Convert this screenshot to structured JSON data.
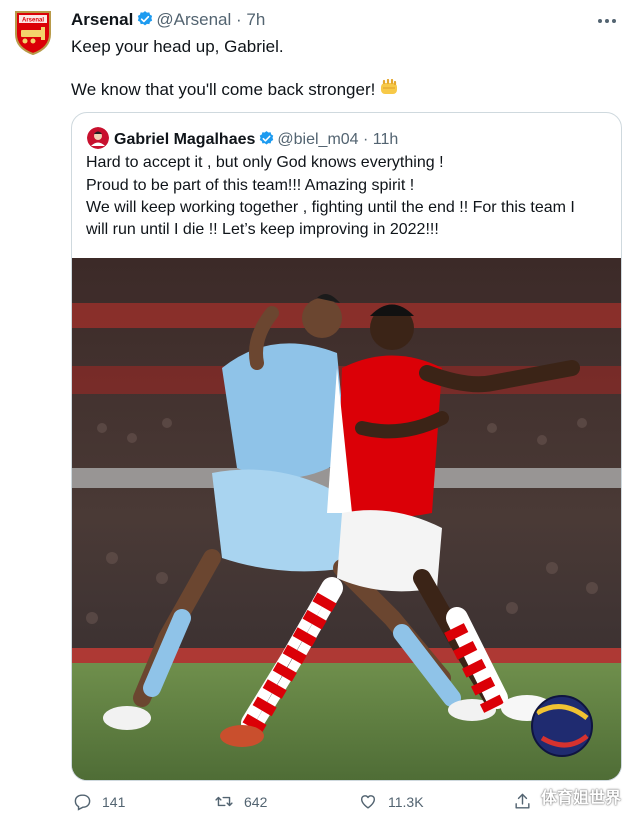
{
  "tweet": {
    "author_name": "Arsenal",
    "handle": "@Arsenal",
    "separator": "·",
    "time": "7h",
    "line1": "Keep your head up, Gabriel.",
    "line2": "We know that you'll come back stronger!",
    "emoji_icon": "fist-emoji-icon"
  },
  "quoted": {
    "author_name": "Gabriel Magalhaes",
    "handle": "@biel_m04",
    "separator": "·",
    "time": "11h",
    "lines": [
      "Hard to accept it , but only God knows everything !",
      "Proud to be part of this team!!! Amazing spirit !",
      "We will keep working together , fighting until the end !! For this team I",
      "will run until I die !! Let’s keep improving in 2022!!!"
    ],
    "photo_description_icon": "football-match-photo"
  },
  "actions": {
    "reply_count": "141",
    "retweet_count": "642",
    "like_count": "11.3K"
  },
  "watermark": "体育姐世界",
  "colors": {
    "verified": "#1d9bf0",
    "muted": "#536471",
    "text": "#0f1419",
    "arsenal_red": "#db0007",
    "city_blue": "#8fc3e8"
  }
}
